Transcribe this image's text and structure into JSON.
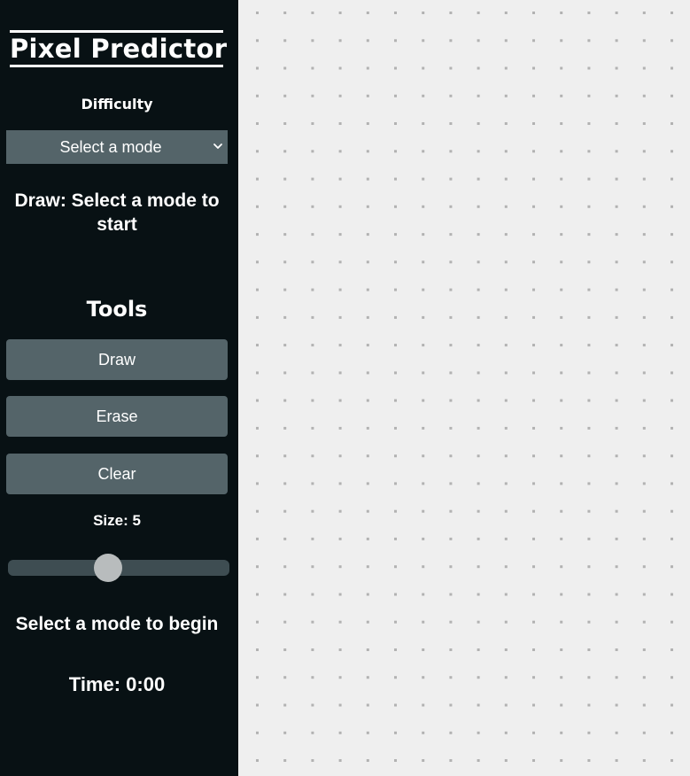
{
  "app": {
    "title": "Pixel Predictor"
  },
  "sidebar": {
    "difficulty_label": "Difficulty",
    "mode_select": {
      "selected": "Select a mode",
      "icon": "chevron-down-icon"
    },
    "draw_prompt": "Draw: Select a mode to start",
    "tools_heading": "Tools",
    "tools": [
      {
        "label": "Draw"
      },
      {
        "label": "Erase"
      },
      {
        "label": "Clear"
      }
    ],
    "size": {
      "label": "Size: 5",
      "value": 5,
      "min": 1,
      "max": 10
    },
    "status": "Select a mode to begin",
    "timer": "Time: 0:00"
  },
  "canvas": {
    "grid": {
      "columns": 16,
      "rows": 28
    }
  },
  "colors": {
    "sidebar_bg": "#081114",
    "control_bg": "#546469",
    "slider_track": "#3e4d52",
    "slider_thumb": "#b8bcbd",
    "canvas_bg": "#efefef",
    "grid_dot": "#b2b2b2",
    "text": "#ffffff"
  }
}
